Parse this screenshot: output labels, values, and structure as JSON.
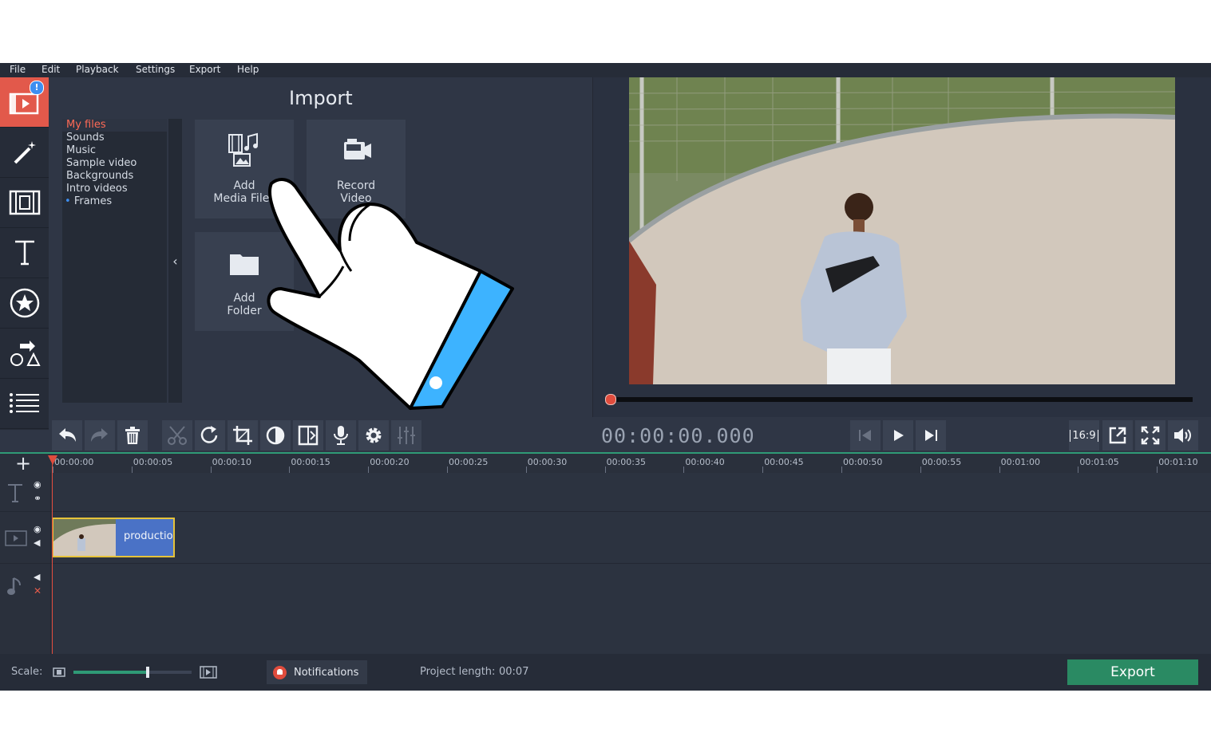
{
  "menu": [
    "File",
    "Edit",
    "Playback",
    "Settings",
    "Export",
    "Help"
  ],
  "sidebar": {
    "badge": "!",
    "items": [
      "import-icon",
      "magic-wand-icon",
      "transitions-icon",
      "titles-icon",
      "stickers-icon",
      "shapes-icon",
      "more-icon"
    ]
  },
  "import": {
    "title": "Import",
    "categories": [
      "My files",
      "Sounds",
      "Music",
      "Sample video",
      "Backgrounds",
      "Intro videos",
      "Frames"
    ],
    "selected": "My files",
    "collapse_glyph": "‹",
    "tiles": [
      {
        "line1": "Add",
        "line2": "Media Files"
      },
      {
        "line1": "Record",
        "line2": "Video"
      },
      {
        "line1": "Add",
        "line2": "Folder"
      }
    ]
  },
  "player": {
    "timecode": "00:00:00.000",
    "aspect": "16:9",
    "progress": 0
  },
  "timeline": {
    "add": "+",
    "ticks": [
      "00:00:00",
      "00:00:05",
      "00:00:10",
      "00:00:15",
      "00:00:20",
      "00:00:25",
      "00:00:30",
      "00:00:35",
      "00:00:40",
      "00:00:45",
      "00:00:50",
      "00:00:55",
      "00:01:00",
      "00:01:05",
      "00:01:10"
    ],
    "clip_label": "productio"
  },
  "status": {
    "scale_label": "Scale:",
    "scale_value": 0.63,
    "notifications": "Notifications",
    "project_length_label": "Project length:",
    "project_length": "00:07",
    "export": "Export"
  },
  "colors": {
    "accent": "#e2594b",
    "export": "#2a8a63",
    "clip": "#4a72c6",
    "cuff": "#3db3ff"
  }
}
